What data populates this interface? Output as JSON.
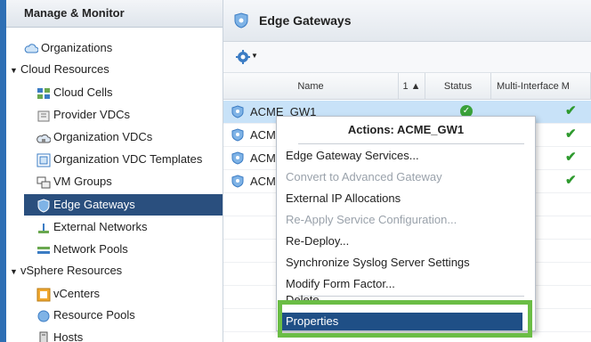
{
  "sidebar": {
    "header": "Manage & Monitor",
    "items": [
      {
        "label": "Organizations",
        "icon": "cloud-icon"
      },
      {
        "label": "Cloud Resources",
        "icon": "caret-down-icon"
      },
      {
        "label": "Cloud Cells",
        "icon": "cloud-cells-icon"
      },
      {
        "label": "Provider VDCs",
        "icon": "provider-vdc-icon"
      },
      {
        "label": "Organization VDCs",
        "icon": "org-vdc-icon"
      },
      {
        "label": "Organization VDC Templates",
        "icon": "vdc-template-icon"
      },
      {
        "label": "VM Groups",
        "icon": "vm-groups-icon"
      },
      {
        "label": "Edge Gateways",
        "icon": "edge-gateway-icon"
      },
      {
        "label": "External Networks",
        "icon": "external-network-icon"
      },
      {
        "label": "Network Pools",
        "icon": "network-pool-icon"
      },
      {
        "label": "vSphere Resources",
        "icon": "caret-down-icon"
      },
      {
        "label": "vCenters",
        "icon": "vcenter-icon"
      },
      {
        "label": "Resource Pools",
        "icon": "resource-pool-icon"
      },
      {
        "label": "Hosts",
        "icon": "host-icon"
      }
    ]
  },
  "main": {
    "title": "Edge Gateways",
    "columns": [
      {
        "label": "Name"
      },
      {
        "label": "1 ▲"
      },
      {
        "label": "Status"
      },
      {
        "label": "Multi-Interface M"
      }
    ],
    "rows": [
      {
        "name": "ACME_GW1"
      },
      {
        "name": "ACME_"
      },
      {
        "name": "ACME_"
      },
      {
        "name": "ACME_"
      }
    ]
  },
  "context_menu": {
    "title": "Actions: ACME_GW1",
    "items": [
      {
        "label": "Edge Gateway Services...",
        "enabled": true
      },
      {
        "label": "Convert to Advanced Gateway",
        "enabled": false
      },
      {
        "label": "External IP Allocations",
        "enabled": true
      },
      {
        "label": "Re-Apply Service Configuration...",
        "enabled": false
      },
      {
        "label": "Re-Deploy...",
        "enabled": true
      },
      {
        "label": "Synchronize Syslog Server Settings",
        "enabled": true
      },
      {
        "label": "Modify Form Factor...",
        "enabled": true
      },
      {
        "label": "Delete",
        "enabled": true
      },
      {
        "label": "Properties",
        "enabled": true
      }
    ]
  },
  "colors": {
    "accent": "#2e6fb4",
    "selected_nav": "#2a4f7e",
    "highlight_box": "#6bbd45",
    "status_green": "#3aa13a"
  }
}
